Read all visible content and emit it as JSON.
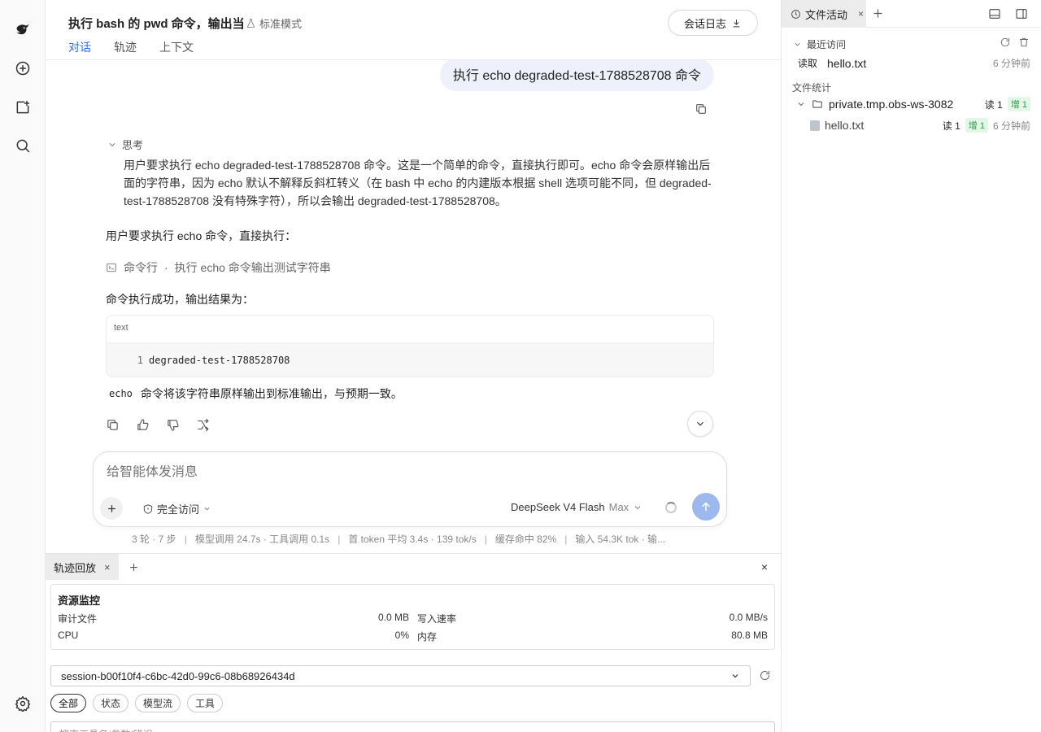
{
  "header": {
    "title": "执行 bash 的 pwd 命令，输出当",
    "mode": "标准模式",
    "log_button": "会话日志",
    "tabs": [
      "对话",
      "轨迹",
      "上下文"
    ]
  },
  "chat": {
    "user_message": "执行 echo degraded-test-1788528708 命令",
    "thinking_label": "思考",
    "thinking_text": "用户要求执行 echo degraded-test-1788528708 命令。这是一个简单的命令，直接执行即可。echo 命令会原样输出后面的字符串，因为 echo 默认不解释反斜杠转义（在 bash 中 echo 的内建版本根据 shell 选项可能不同，但 degraded-test-1788528708 没有特殊字符），所以会输出 degraded-test-1788528708。",
    "reply_intro": "用户要求执行 echo 命令，直接执行：",
    "tool_call": {
      "label": "命令行",
      "separator": "·",
      "description": "执行 echo 命令输出测试字符串"
    },
    "result_intro": "命令执行成功，输出结果为：",
    "code": {
      "lang": "text",
      "line_number": "1",
      "line": "degraded-test-1788528708"
    },
    "closing_code": "echo",
    "closing_text": "命令将该字符串原样输出到标准输出，与预期一致。"
  },
  "composer": {
    "placeholder": "给智能体发消息",
    "access": "完全访问",
    "model": "DeepSeek V4 Flash",
    "model_level": "Max"
  },
  "stats": {
    "items": [
      "3 轮 · 7 步",
      "模型调用 24.7s · 工具调用 0.1s",
      "首 token 平均 3.4s · 139 tok/s",
      "缓存命中 82%",
      "输入 54.3K tok · 输..."
    ],
    "separator": "|"
  },
  "bottom_panel": {
    "tab": "轨迹回放",
    "close_glyph": "×",
    "resources": {
      "title": "资源监控",
      "audit_label": "审计文件",
      "audit_value": "0.0 MB",
      "write_label": "写入速率",
      "write_value": "0.0 MB/s",
      "cpu_label": "CPU",
      "cpu_value": "0%",
      "mem_label": "内存",
      "mem_value": "80.8 MB"
    },
    "session": "session-b00f10f4-c6bc-42d0-99c6-08b68926434d",
    "filters": [
      "全部",
      "状态",
      "模型流",
      "工具"
    ],
    "search_placeholder": "搜索工具名/参数/错误"
  },
  "right_panel": {
    "tab": "文件活动",
    "tab_close": "×",
    "recent_label": "最近访问",
    "recent": {
      "op": "读取",
      "file": "hello.txt",
      "time": "6 分钟前"
    },
    "stats_label": "文件统计",
    "folder": {
      "name": "private.tmp.obs-ws-3082",
      "read": "读 1",
      "add": "增 1"
    },
    "file": {
      "name": "hello.txt",
      "read": "读 1",
      "add": "增 1",
      "time": "6 分钟前"
    }
  },
  "colors": {
    "accent": "#2f6fea",
    "send": "#9cb8ef",
    "bubble": "#eef1fb",
    "add_badge": "#2a9a4a"
  }
}
